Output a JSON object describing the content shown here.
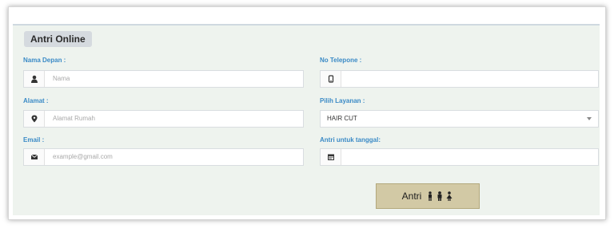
{
  "form": {
    "title": "Antri Online",
    "fields": {
      "nama": {
        "label": "Nama Depan :",
        "placeholder": "Nama",
        "icon": "user-icon"
      },
      "telepon": {
        "label": "No Telepone :",
        "placeholder": "",
        "icon": "phone-icon"
      },
      "alamat": {
        "label": "Alamat :",
        "placeholder": "Alamat Rumah",
        "icon": "map-marker-icon"
      },
      "layanan": {
        "label": "Pilih Layanan :",
        "value": "HAIR CUT"
      },
      "email": {
        "label": "Email :",
        "placeholder": "example@gmail.com",
        "icon": "envelope-icon"
      },
      "tanggal": {
        "label": "Antri untuk tanggal:",
        "placeholder": "",
        "icon": "calendar-icon"
      }
    },
    "submit_label": "Antri"
  },
  "colors": {
    "panel_bg": "#eef3ee",
    "label": "#3a8ac6",
    "button_bg": "#d2c9a5"
  }
}
